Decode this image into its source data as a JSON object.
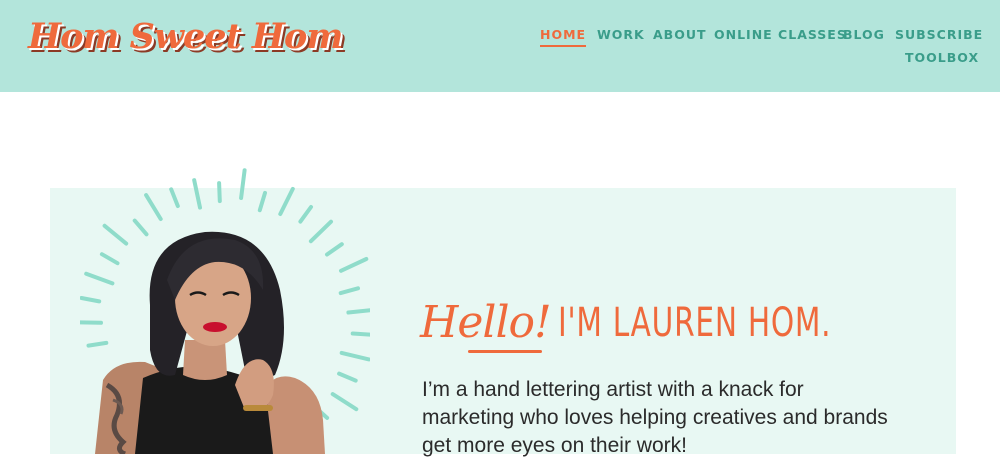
{
  "header": {
    "logo_text": "Hom Sweet Hom",
    "background_color": "#b3e5db"
  },
  "nav": {
    "items": [
      {
        "label": "HOME",
        "active": true
      },
      {
        "label": "WORK",
        "active": false
      },
      {
        "label": "ABOUT",
        "active": false
      },
      {
        "label": "ONLINE CLASSES",
        "active": false
      },
      {
        "label": "BLOG",
        "active": false
      },
      {
        "label": "SUBSCRIBE",
        "active": false
      },
      {
        "label": "TOOLBOX",
        "active": false
      }
    ],
    "active_color": "#ef6a3c",
    "link_color": "#3a9d8a"
  },
  "hero": {
    "hello_script": "Hello!",
    "headline": "I'M LAUREN HOM.",
    "intro": "I’m a hand lettering artist with a knack for marketing who loves helping creatives and brands get more eyes on their work!",
    "background_color": "#e8f8f3",
    "accent_color": "#ef6a3c"
  }
}
